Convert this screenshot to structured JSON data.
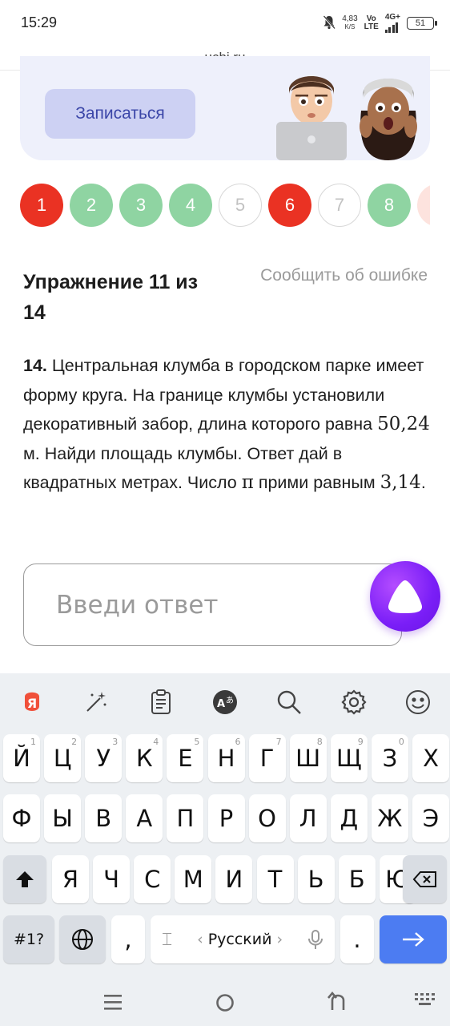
{
  "status": {
    "time": "15:29",
    "speed_top": "4,83",
    "speed_bottom": "K/S",
    "net_top": "Vo",
    "net_bottom": "LTE",
    "net_type": "4G+",
    "battery": "51"
  },
  "browser": {
    "url": "uchi.ru"
  },
  "promo": {
    "button_label": "Записаться"
  },
  "steps": [
    {
      "label": "1",
      "state": "wrong"
    },
    {
      "label": "2",
      "state": "correct"
    },
    {
      "label": "3",
      "state": "correct"
    },
    {
      "label": "4",
      "state": "correct"
    },
    {
      "label": "5",
      "state": "empty"
    },
    {
      "label": "6",
      "state": "wrong"
    },
    {
      "label": "7",
      "state": "empty"
    },
    {
      "label": "8",
      "state": "correct"
    }
  ],
  "exercise": {
    "title": "Упражнение 11 из 14",
    "report_link": "Сообщить об ошибке"
  },
  "task": {
    "number": "14.",
    "text_1": " Центральная клумба в городском парке имеет форму круга. На границе клумбы установили декоративный забор, длина которого равна ",
    "value_length": "50,24",
    "text_2": " м. Найди площадь клумбы. Ответ дай в квадратных метрах. Число ",
    "pi": "π",
    "text_3": " прими равным ",
    "value_pi": "3,14",
    "text_4": "."
  },
  "answer": {
    "placeholder": "Введи ответ",
    "value": ""
  },
  "keyboard": {
    "row1": [
      "Й",
      "Ц",
      "У",
      "К",
      "Е",
      "Н",
      "Г",
      "Ш",
      "Щ",
      "З",
      "Х"
    ],
    "row1_hints": [
      "1",
      "2",
      "3",
      "4",
      "5",
      "6",
      "7",
      "8",
      "9",
      "0",
      ""
    ],
    "row2": [
      "Ф",
      "Ы",
      "В",
      "А",
      "П",
      "Р",
      "О",
      "Л",
      "Д",
      "Ж",
      "Э"
    ],
    "row3": [
      "Я",
      "Ч",
      "С",
      "М",
      "И",
      "Т",
      "Ь",
      "Б",
      "Ю"
    ],
    "symbols_label": "#1?",
    "comma_label": ",",
    "language_label": "Русский",
    "period_label": "."
  }
}
